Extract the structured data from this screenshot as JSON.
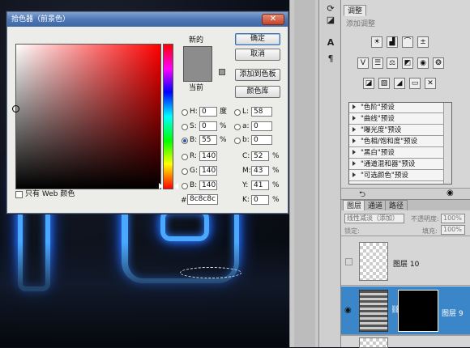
{
  "dialog": {
    "title": "拾色器（前景色）",
    "close_symbol": "✕",
    "new_label": "新的",
    "current_label": "当前",
    "buttons": {
      "ok": "确定",
      "cancel": "取消",
      "add_swatch": "添加到色板",
      "color_libraries": "颜色库"
    },
    "web_only_label": "只有 Web 颜色",
    "new_color": "#8c8c8c",
    "current_color": "#8c8c8c",
    "hsb": {
      "h_label": "H:",
      "h_value": "0",
      "h_unit": "度",
      "s_label": "S:",
      "s_value": "0",
      "s_unit": "%",
      "b_label": "B:",
      "b_value": "55",
      "b_unit": "%"
    },
    "rgb": {
      "r_label": "R:",
      "r_value": "140",
      "g_label": "G:",
      "g_value": "140",
      "b_label": "B:",
      "b_value": "140"
    },
    "lab": {
      "l_label": "L:",
      "l_value": "58",
      "a_label": "a:",
      "a_value": "0",
      "b_label": "b:",
      "b_value": "0"
    },
    "cmyk": {
      "c_label": "C:",
      "c_value": "52",
      "c_unit": "%",
      "m_label": "M:",
      "m_value": "43",
      "m_unit": "%",
      "y_label": "Y:",
      "y_value": "41",
      "y_unit": "%",
      "k_label": "K:",
      "k_value": "0",
      "k_unit": "%"
    },
    "hex_label": "#",
    "hex_value": "8c8c8c",
    "selected_mode": "B"
  },
  "panel": {
    "tab_adjustments": "调整",
    "add_adjustment": "添加调整",
    "presets": [
      "\"色阶\"预设",
      "\"曲线\"预设",
      "\"曝光度\"预设",
      "\"色相/饱和度\"预设",
      "\"黑白\"预设",
      "\"通道混和器\"预设",
      "\"可选颜色\"预设"
    ],
    "layer_tabs": [
      "图层",
      "通道",
      "路径"
    ],
    "blend_mode": "线性减淡（添加）",
    "opacity_label": "不透明度:",
    "opacity_value": "100%",
    "lock_label": "锁定:",
    "fill_label": "填充:",
    "fill_value": "100%",
    "layers": [
      {
        "name": "图层 10"
      },
      {
        "name": "图层 9"
      }
    ]
  },
  "colors": {
    "accent": "#3a86c8",
    "title_bar": "#4e78b5",
    "neon": "#4aa8ff"
  }
}
